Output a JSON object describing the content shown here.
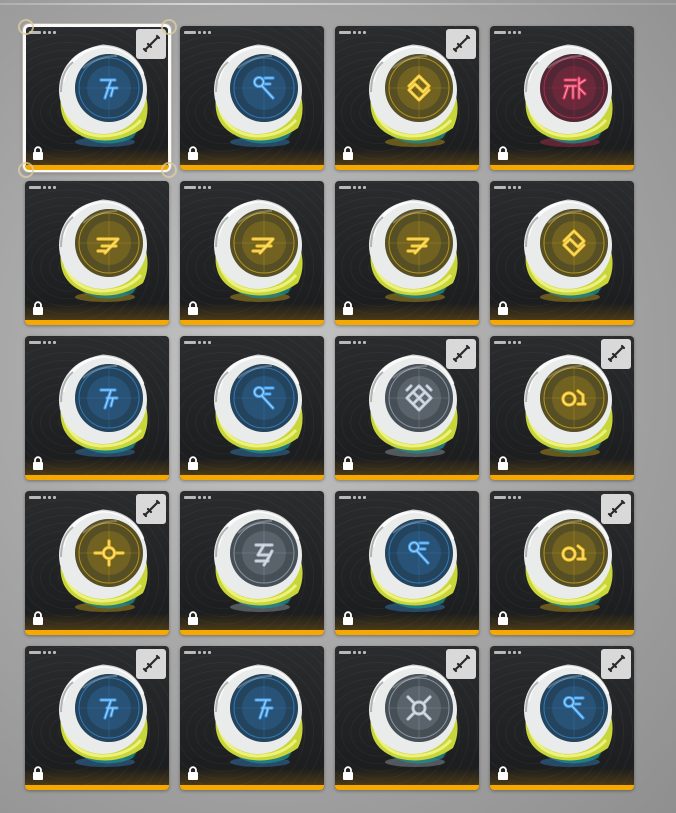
{
  "screen": {
    "accent_color": "#f5a800",
    "background_color": "#a9a9a9"
  },
  "items": [
    {
      "glyph": "rune-a",
      "glow": "#3d9be9",
      "weapon": true,
      "locked": true,
      "selected": true
    },
    {
      "glyph": "rune-key",
      "glow": "#3d9be9",
      "weapon": false,
      "locked": true,
      "selected": false
    },
    {
      "glyph": "rune-knot",
      "glow": "#f2c21b",
      "weapon": true,
      "locked": true,
      "selected": false
    },
    {
      "glyph": "rune-gate",
      "glow": "#e0345a",
      "weapon": false,
      "locked": true,
      "selected": false
    },
    {
      "glyph": "rune-bolt",
      "glow": "#f2c21b",
      "weapon": false,
      "locked": true,
      "selected": false
    },
    {
      "glyph": "rune-bolt",
      "glow": "#f2c21b",
      "weapon": false,
      "locked": true,
      "selected": false
    },
    {
      "glyph": "rune-bolt",
      "glow": "#f2c21b",
      "weapon": false,
      "locked": true,
      "selected": false
    },
    {
      "glyph": "rune-knot",
      "glow": "#f2c21b",
      "weapon": false,
      "locked": true,
      "selected": false
    },
    {
      "glyph": "rune-a",
      "glow": "#3d9be9",
      "weapon": false,
      "locked": true,
      "selected": false
    },
    {
      "glyph": "rune-key",
      "glow": "#3d9be9",
      "weapon": false,
      "locked": true,
      "selected": false
    },
    {
      "glyph": "rune-diamond",
      "glow": "#b6c2cf",
      "weapon": true,
      "locked": true,
      "selected": false
    },
    {
      "glyph": "rune-ring",
      "glow": "#f2c21b",
      "weapon": true,
      "locked": true,
      "selected": false
    },
    {
      "glyph": "rune-eye",
      "glow": "#f2c21b",
      "weapon": true,
      "locked": true,
      "selected": false
    },
    {
      "glyph": "rune-split",
      "glow": "#b6c2cf",
      "weapon": false,
      "locked": true,
      "selected": false
    },
    {
      "glyph": "rune-key",
      "glow": "#3d9be9",
      "weapon": false,
      "locked": true,
      "selected": false
    },
    {
      "glyph": "rune-ring",
      "glow": "#f2c21b",
      "weapon": true,
      "locked": true,
      "selected": false
    },
    {
      "glyph": "rune-a",
      "glow": "#3d9be9",
      "weapon": true,
      "locked": true,
      "selected": false
    },
    {
      "glyph": "rune-a",
      "glow": "#3d9be9",
      "weapon": false,
      "locked": true,
      "selected": false
    },
    {
      "glyph": "rune-cross",
      "glow": "#b6c2cf",
      "weapon": true,
      "locked": true,
      "selected": false
    },
    {
      "glyph": "rune-key",
      "glow": "#3d9be9",
      "weapon": true,
      "locked": true,
      "selected": false
    }
  ],
  "icons": {
    "weapon": "sword-icon",
    "locked": "lock-icon"
  }
}
